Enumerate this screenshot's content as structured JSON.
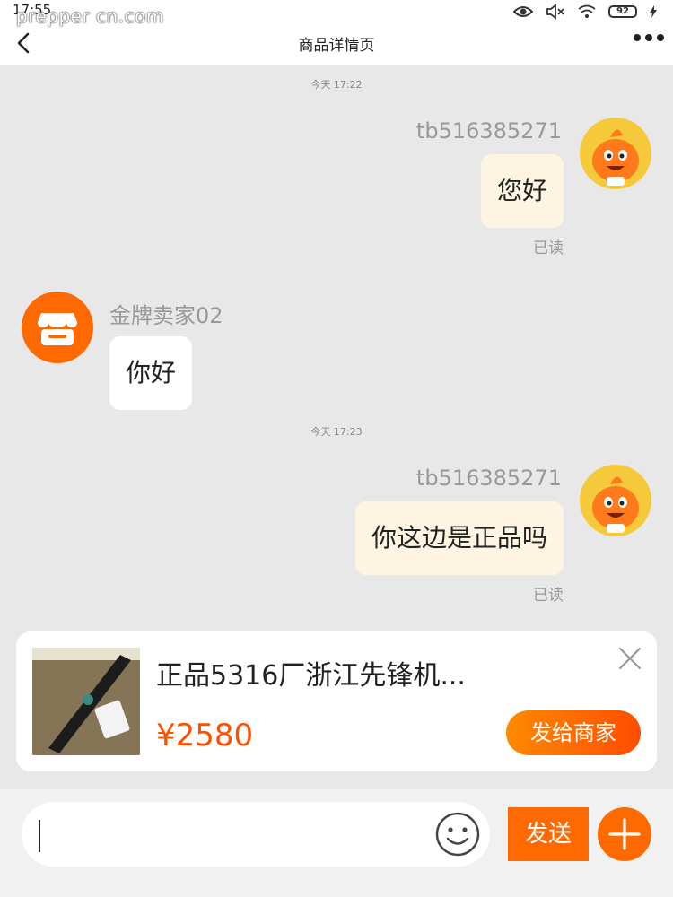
{
  "status": {
    "time": "17:55",
    "watermark": "prepper cn.com",
    "battery": "92"
  },
  "nav": {
    "title": "商品详情页"
  },
  "messages": [
    {
      "timestamp": "今天 17:22",
      "sender": "tb516385271",
      "text": "您好",
      "direction": "out",
      "read": "已读"
    },
    {
      "sender": "金牌卖家02",
      "text": "你好",
      "direction": "in"
    },
    {
      "timestamp": "今天 17:23",
      "sender": "tb516385271",
      "text": "你这边是正品吗",
      "direction": "out",
      "read": "已读"
    }
  ],
  "product": {
    "title": "正品5316厂浙江先锋机...",
    "price": "¥2580",
    "send_label": "发给商家"
  },
  "input": {
    "value": "",
    "send_label": "发送"
  },
  "colors": {
    "accent": "#ff6a00",
    "price": "#ff5000",
    "bubble_out": "#fdf5e2"
  }
}
